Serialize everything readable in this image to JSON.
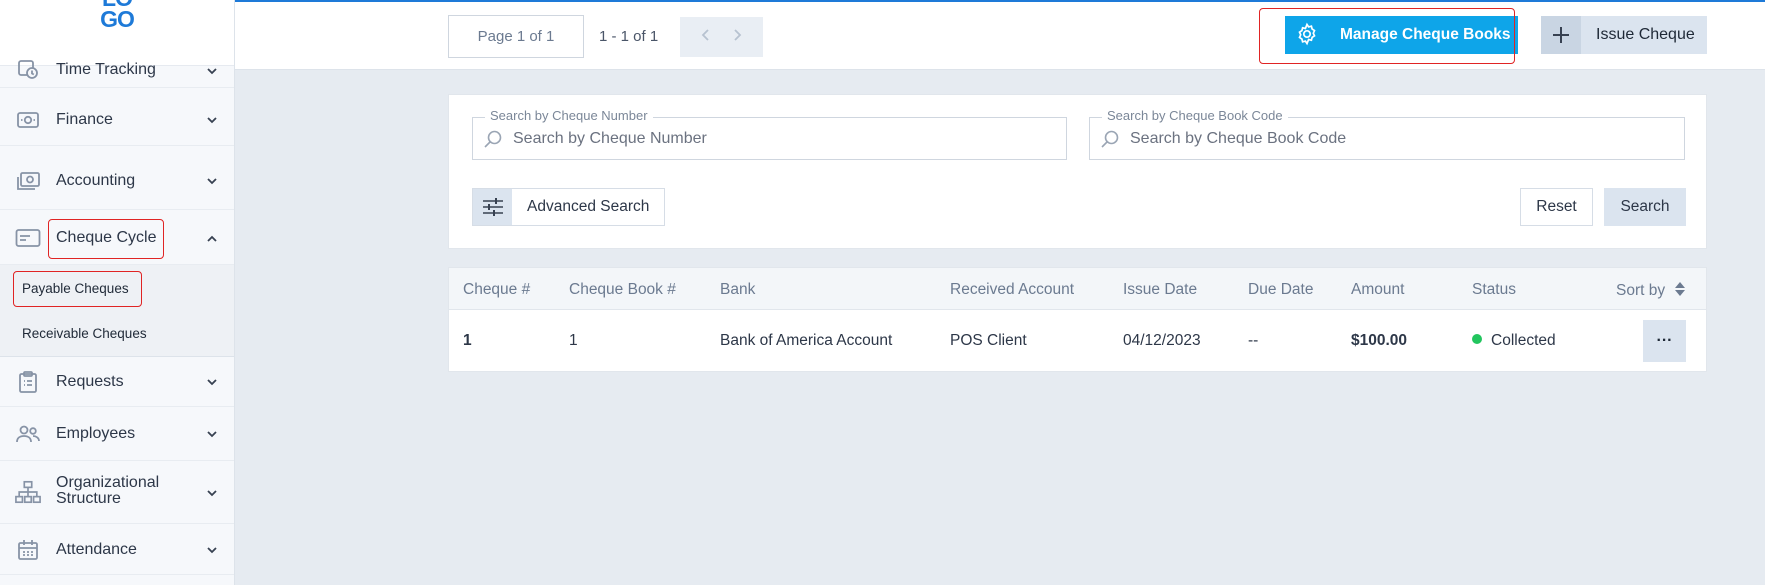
{
  "app": {
    "logo_text": "LO\nGO"
  },
  "sidebar": {
    "items": [
      {
        "label": "Time Tracking",
        "icon": "clock-icon"
      },
      {
        "label": "Finance",
        "icon": "finance-icon"
      },
      {
        "label": "Accounting",
        "icon": "money-icon"
      },
      {
        "label": "Cheque Cycle",
        "icon": "cheque-icon",
        "expanded": true
      },
      {
        "label": "Requests",
        "icon": "clipboard-icon"
      },
      {
        "label": "Employees",
        "icon": "people-icon"
      },
      {
        "label": "Organizational Structure",
        "icon": "org-chart-icon"
      },
      {
        "label": "Attendance",
        "icon": "calendar-icon"
      }
    ],
    "sub_items": [
      {
        "label": "Payable Cheques",
        "active": true
      },
      {
        "label": "Receivable Cheques"
      }
    ]
  },
  "pager": {
    "page_label": "Page 1 of 1",
    "range_label": "1 - 1 of 1"
  },
  "actions": {
    "manage_label": "Manage Cheque Books",
    "issue_label": "Issue Cheque"
  },
  "search": {
    "cheque_number_label": "Search by Cheque Number",
    "cheque_number_placeholder": "Search by Cheque Number",
    "cheque_book_label": "Search by Cheque Book Code",
    "cheque_book_placeholder": "Search by Cheque Book Code",
    "advanced_label": "Advanced Search",
    "reset_label": "Reset",
    "search_label": "Search"
  },
  "table": {
    "columns": [
      "Cheque #",
      "Cheque Book #",
      "Bank",
      "Received Account",
      "Issue Date",
      "Due Date",
      "Amount",
      "Status",
      "Sort by"
    ],
    "rows": [
      {
        "cheque": "1",
        "book": "1",
        "bank": "Bank of America Account",
        "account": "POS Client",
        "issue_date": "04/12/2023",
        "due_date": "--",
        "amount": "$100.00",
        "status": "Collected",
        "more": "···"
      }
    ]
  },
  "colors": {
    "accent": "#0ea5e9",
    "brand": "#1e7ad8",
    "highlight": "#e02424",
    "status_collected": "#22c55e"
  }
}
